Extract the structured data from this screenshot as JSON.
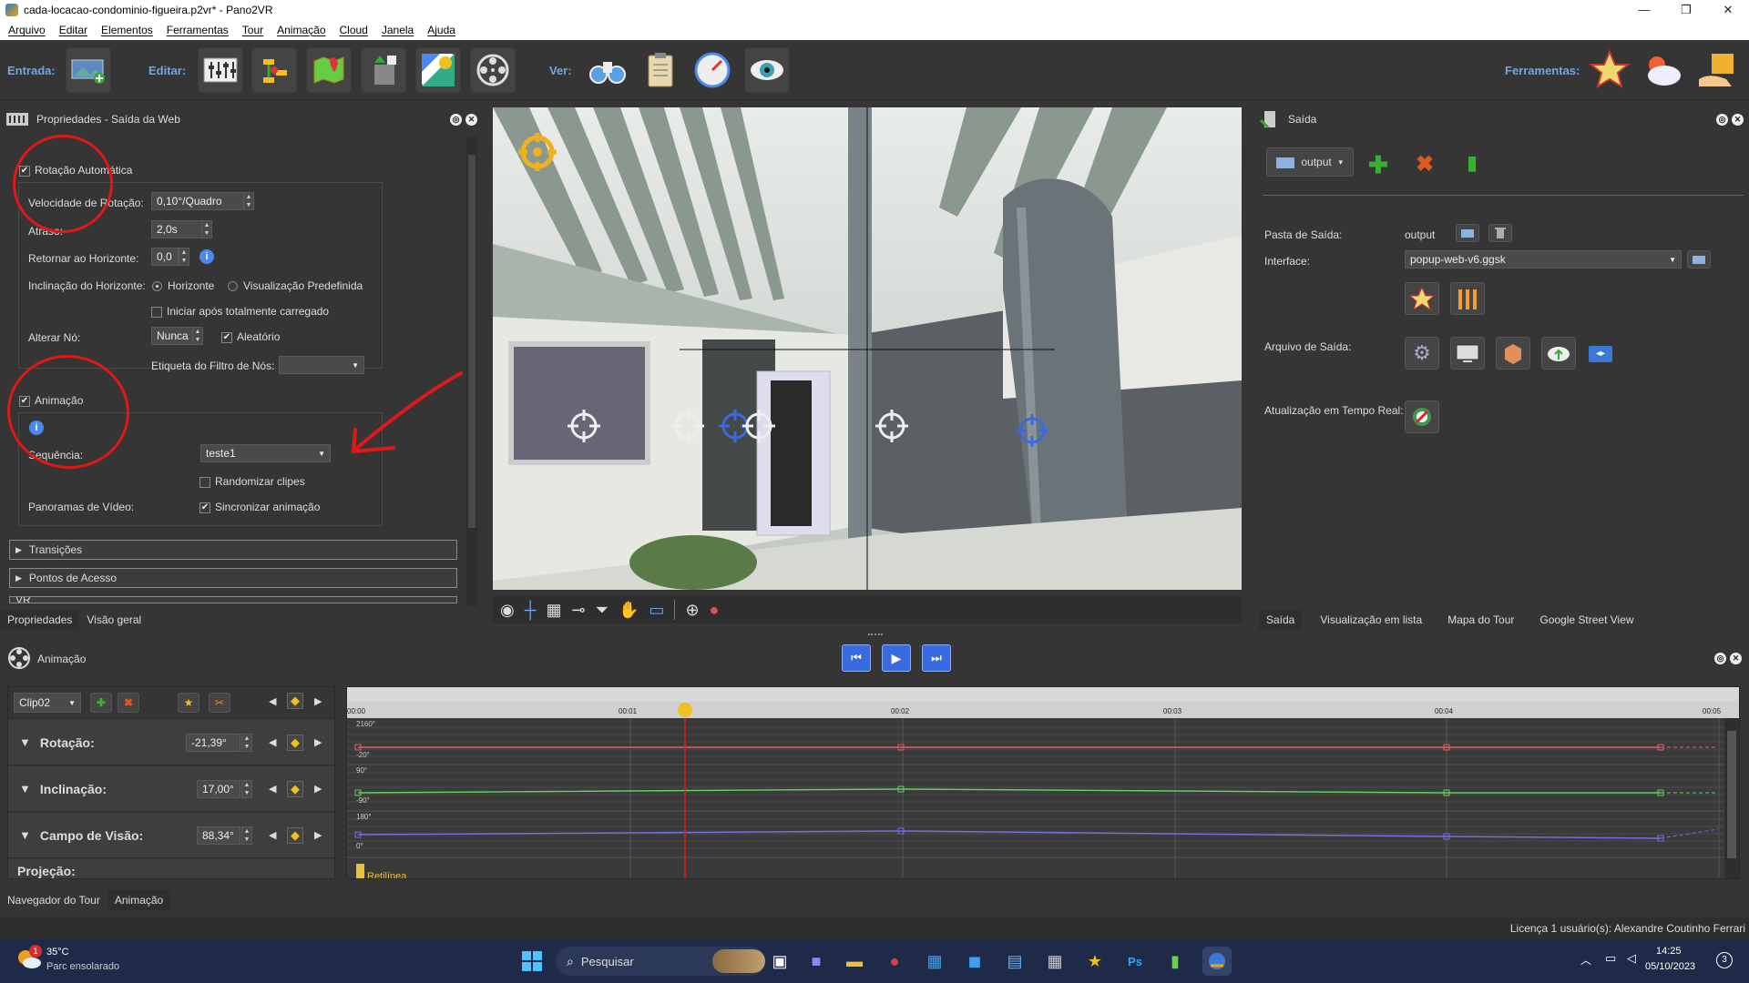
{
  "window": {
    "title": "cada-locacao-condominio-figueira.p2vr* - Pano2VR",
    "min": "—",
    "max": "❐",
    "close": "✕"
  },
  "menu": [
    "Arquivo",
    "Editar",
    "Elementos",
    "Ferramentas",
    "Tour",
    "Animação",
    "Cloud",
    "Janela",
    "Ajuda"
  ],
  "toolbar": {
    "entrada": "Entrada:",
    "editar": "Editar:",
    "ver": "Ver:",
    "ferramentas": "Ferramentas:"
  },
  "left_panel": {
    "title": "Propriedades - Saída da Web",
    "auto_rotation": {
      "label": "Rotação Automática",
      "checked": true
    },
    "speed": {
      "label": "Velocidade de Rotação:",
      "value": "0,10°/Quadro"
    },
    "delay": {
      "label": "Atraso:",
      "value": "2,0s"
    },
    "return_horizon": {
      "label": "Retornar ao Horizonte:",
      "value": "0,0"
    },
    "tilt_horizon": {
      "label": "Inclinação do Horizonte:",
      "opt1": "Horizonte",
      "opt2": "Visualização Predefinida"
    },
    "start_loaded": {
      "label": "Iniciar após totalmente carregado"
    },
    "change_node": {
      "label": "Alterar Nó:",
      "value": "Nunca",
      "random": "Aleatório"
    },
    "node_filter": {
      "label": "Etiqueta do Filtro de Nós:",
      "value": ""
    },
    "animation": {
      "label": "Animação",
      "checked": true
    },
    "sequence": {
      "label": "Sequência:",
      "value": "teste1"
    },
    "randomize": {
      "label": "Randomizar clipes"
    },
    "video_panos": {
      "label": "Panoramas de Vídeo:",
      "sync": "Sincronizar animação"
    },
    "sections": [
      "Transições",
      "Pontos de Acesso",
      "VR"
    ],
    "tabs": [
      "Propriedades",
      "Visão geral"
    ]
  },
  "right_panel": {
    "title": "Saída",
    "output_btn": "output",
    "output_folder": {
      "label": "Pasta de Saída:",
      "value": "output"
    },
    "interface": {
      "label": "Interface:",
      "value": "popup-web-v6.ggsk"
    },
    "output_file": {
      "label": "Arquivo de Saída:"
    },
    "realtime": {
      "label": "Atualização em Tempo Real:"
    },
    "tabs": [
      "Saída",
      "Visualização em lista",
      "Mapa do Tour",
      "Google Street View"
    ]
  },
  "animation_panel": {
    "title": "Animação",
    "clip": "Clip02",
    "tracks": [
      {
        "label": "Rotação:",
        "value": "-21,39°",
        "top": "2160°",
        "bottom": "-20°"
      },
      {
        "label": "Inclinação:",
        "value": "17,00°",
        "top": "90°",
        "bottom": "-90°"
      },
      {
        "label": "Campo de Visão:",
        "value": "88,34°",
        "top": "180°",
        "bottom": "0°"
      },
      {
        "label": "Projeção:",
        "value": "",
        "top": "Retilínea",
        "bottom": ""
      }
    ],
    "ruler": [
      "00:00",
      "00:01",
      "00:02",
      "00:03",
      "00:04",
      "00:05"
    ],
    "bottom_tabs": [
      "Navegador do Tour",
      "Animação"
    ]
  },
  "status": {
    "license": "Licença 1 usuário(s): Alexandre Coutinho Ferrari"
  },
  "taskbar": {
    "weather_temp": "35°C",
    "weather_desc": "Parc ensolarado",
    "weather_badge": "1",
    "search": "Pesquisar",
    "time": "14:25",
    "date": "05/10/2023",
    "notif": "3"
  },
  "colors": {
    "accent": "#6fa6e6",
    "annotation": "#e01818",
    "playhead": "#e02020"
  }
}
